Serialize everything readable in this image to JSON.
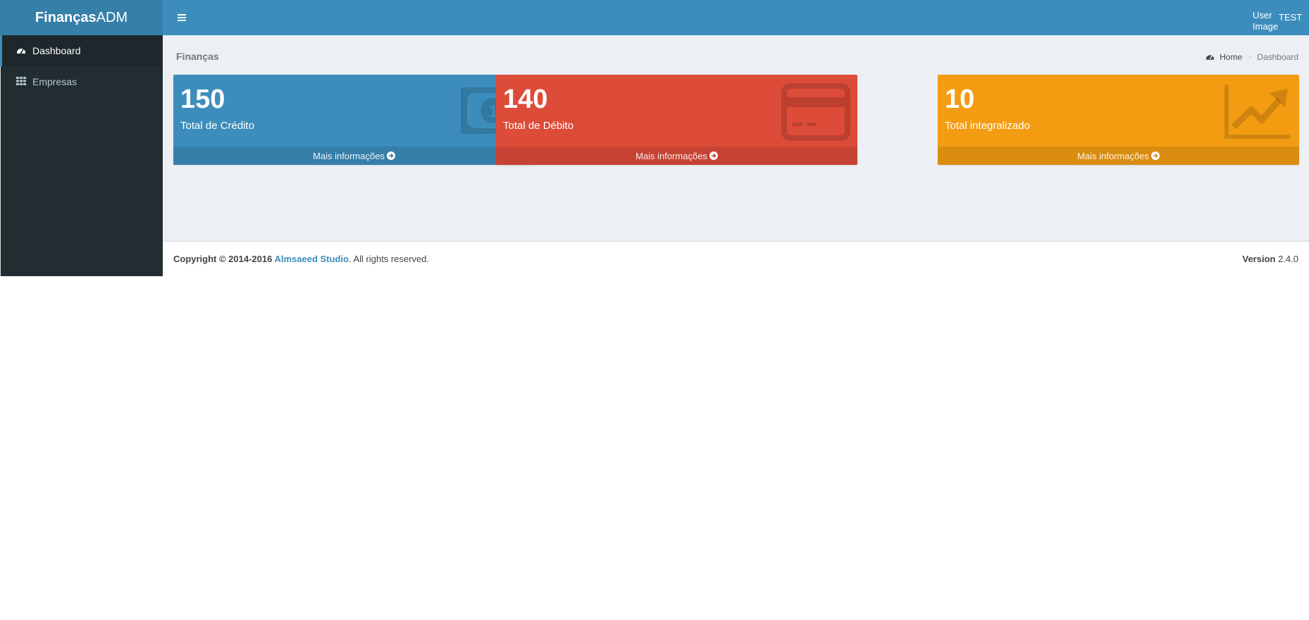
{
  "brand": {
    "bold": "Finanças",
    "light": "ADM"
  },
  "header": {
    "user_image_alt": "User Image",
    "user_name": "TEST"
  },
  "sidebar": {
    "items": [
      {
        "label": "Dashboard",
        "icon": "dashboard-icon",
        "active": true
      },
      {
        "label": "Empresas",
        "icon": "grid-icon",
        "active": false
      }
    ]
  },
  "main": {
    "title": "Finanças",
    "breadcrumb": {
      "home": "Home",
      "current": "Dashboard",
      "separator": ">"
    },
    "boxes": [
      {
        "value": "150",
        "label": "Total de Crédito",
        "link": "Mais informações",
        "icon": "money-icon",
        "color": "#3c8dbc",
        "footer_color": "#367fa9"
      },
      {
        "value": "140",
        "label": "Total de Débito",
        "link": "Mais informações",
        "icon": "credit-card-icon",
        "color": "#dd4b39",
        "footer_color": "#c64333"
      },
      {
        "value": "10",
        "label": "Total integralizado",
        "link": "Mais informações",
        "icon": "line-chart-icon",
        "color": "#f39c12",
        "footer_color": "#da8c10"
      }
    ]
  },
  "footer": {
    "copyright_prefix": "Copyright © 2014-2016 ",
    "company": "Almsaeed Studio",
    "suffix": ". All rights reserved.",
    "version_label": "Version",
    "version_value": "2.4.0"
  }
}
